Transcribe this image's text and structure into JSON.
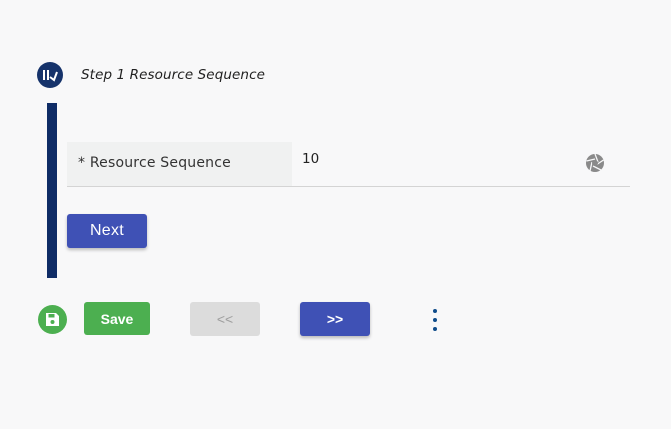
{
  "step": {
    "icon": "step-badge-icon",
    "title": "Step 1 Resource Sequence"
  },
  "field": {
    "label": "* Resource Sequence",
    "value": "10",
    "trailing_icon": "aperture-icon"
  },
  "buttons": {
    "next": "Next",
    "save": "Save",
    "prev": "<<",
    "forward": ">>"
  },
  "icons": {
    "save": "floppy-disk-icon",
    "more": "more-vertical-icon"
  },
  "colors": {
    "primary": "#3f51b5",
    "navy": "#0f2c66",
    "success": "#4caf50",
    "disabled": "#dcdcdc"
  }
}
